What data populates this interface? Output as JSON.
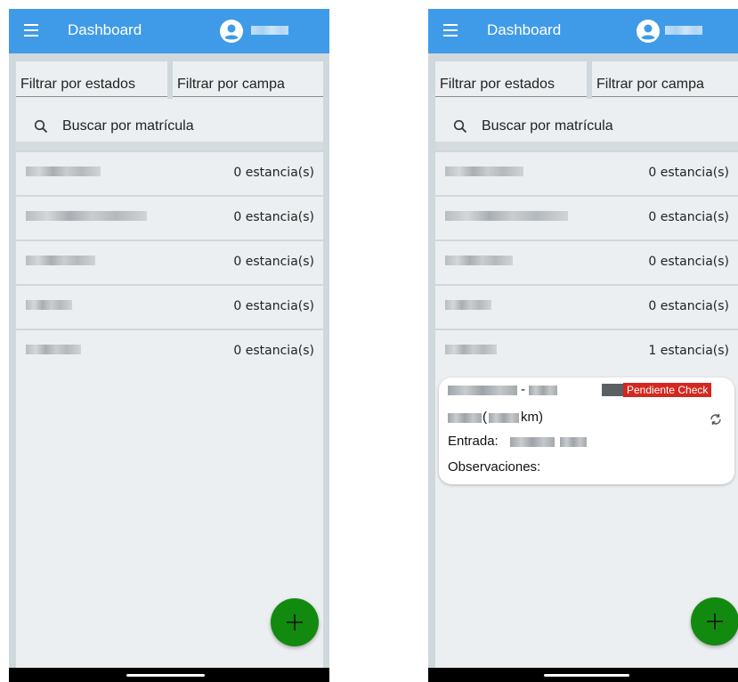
{
  "screens": [
    {
      "header": {
        "title": "Dashboard"
      },
      "filters": {
        "states": "Filtrar por estados",
        "campaign": "Filtrar por campa"
      },
      "search": {
        "placeholder": "Buscar por matrícula"
      },
      "rows": [
        {
          "count": "0 estancia(s)"
        },
        {
          "count": "0 estancia(s)"
        },
        {
          "count": "0 estancia(s)"
        },
        {
          "count": "0 estancia(s)"
        },
        {
          "count": "0 estancia(s)"
        }
      ]
    },
    {
      "header": {
        "title": "Dashboard"
      },
      "filters": {
        "states": "Filtrar por estados",
        "campaign": "Filtrar por campa"
      },
      "search": {
        "placeholder": "Buscar por matrícula"
      },
      "rows": [
        {
          "count": "0 estancia(s)"
        },
        {
          "count": "0 estancia(s)"
        },
        {
          "count": "0 estancia(s)"
        },
        {
          "count": "0 estancia(s)"
        },
        {
          "count": "1 estancia(s)"
        }
      ],
      "card": {
        "separator": "-",
        "status_badge": "Pendiente Check",
        "distance_open": "(",
        "distance_unit": "km)",
        "entry_label": "Entrada:",
        "observations_label": "Observaciones:"
      }
    }
  ],
  "icons": {
    "menu": "menu-icon",
    "user": "account-circle-icon",
    "search": "search-icon",
    "sync": "sync-icon",
    "add": "add-icon"
  },
  "colors": {
    "appbar": "#3f9be8",
    "fab": "#128a0f",
    "badge": "#d3281f",
    "background": "#cfd8dc",
    "surface": "#eceff1"
  }
}
